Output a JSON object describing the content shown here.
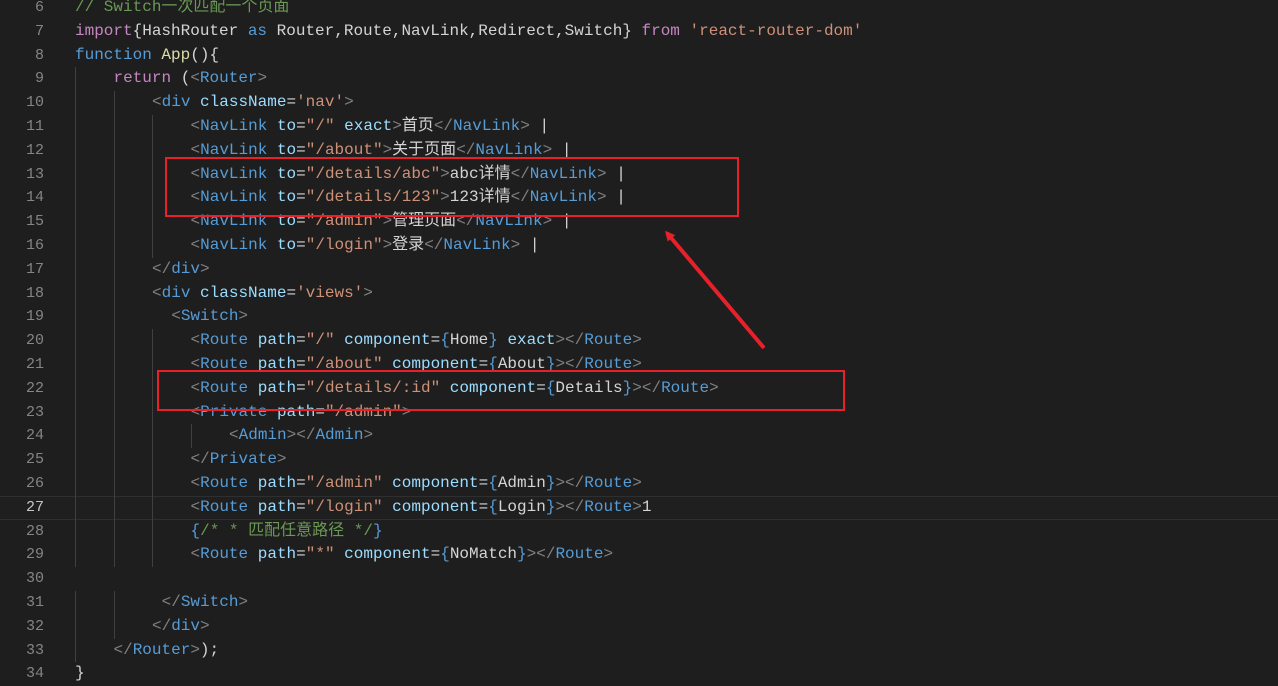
{
  "editor": {
    "current_line": 27,
    "lines": [
      {
        "n": "6",
        "indent": 0,
        "tokens": [
          {
            "t": "cmt",
            "v": "// Switch一次匹配一个页面"
          }
        ]
      },
      {
        "n": "7",
        "indent": 0,
        "tokens": [
          {
            "t": "kw2",
            "v": "import"
          },
          {
            "t": "txt",
            "v": "{HashRouter "
          },
          {
            "t": "kw",
            "v": "as"
          },
          {
            "t": "txt",
            "v": " Router,Route,NavLink,Redirect,Switch} "
          },
          {
            "t": "kw2",
            "v": "from"
          },
          {
            "t": "txt",
            "v": " "
          },
          {
            "t": "str",
            "v": "'react-router-dom'"
          }
        ]
      },
      {
        "n": "8",
        "indent": 0,
        "tokens": [
          {
            "t": "kw",
            "v": "function"
          },
          {
            "t": "txt",
            "v": " "
          },
          {
            "t": "fn",
            "v": "App"
          },
          {
            "t": "txt",
            "v": "(){"
          }
        ]
      },
      {
        "n": "9",
        "indent": 1,
        "tokens": [
          {
            "t": "kw2",
            "v": "return"
          },
          {
            "t": "txt",
            "v": " ("
          },
          {
            "t": "pun",
            "v": "<"
          },
          {
            "t": "tag",
            "v": "Router"
          },
          {
            "t": "pun",
            "v": ">"
          }
        ]
      },
      {
        "n": "10",
        "indent": 2,
        "tokens": [
          {
            "t": "pun",
            "v": "<"
          },
          {
            "t": "tag",
            "v": "div"
          },
          {
            "t": "txt",
            "v": " "
          },
          {
            "t": "attr",
            "v": "className"
          },
          {
            "t": "txt",
            "v": "="
          },
          {
            "t": "str",
            "v": "'nav'"
          },
          {
            "t": "pun",
            "v": ">"
          }
        ]
      },
      {
        "n": "11",
        "indent": 3,
        "tokens": [
          {
            "t": "pun",
            "v": "<"
          },
          {
            "t": "tag",
            "v": "NavLink"
          },
          {
            "t": "txt",
            "v": " "
          },
          {
            "t": "attr",
            "v": "to"
          },
          {
            "t": "txt",
            "v": "="
          },
          {
            "t": "str",
            "v": "\"/\""
          },
          {
            "t": "txt",
            "v": " "
          },
          {
            "t": "attr",
            "v": "exact"
          },
          {
            "t": "pun",
            "v": ">"
          },
          {
            "t": "txt",
            "v": "首页"
          },
          {
            "t": "pun",
            "v": "</"
          },
          {
            "t": "tag",
            "v": "NavLink"
          },
          {
            "t": "pun",
            "v": ">"
          },
          {
            "t": "txt",
            "v": " |"
          }
        ]
      },
      {
        "n": "12",
        "indent": 3,
        "tokens": [
          {
            "t": "pun",
            "v": "<"
          },
          {
            "t": "tag",
            "v": "NavLink"
          },
          {
            "t": "txt",
            "v": " "
          },
          {
            "t": "attr",
            "v": "to"
          },
          {
            "t": "txt",
            "v": "="
          },
          {
            "t": "str",
            "v": "\"/about\""
          },
          {
            "t": "pun",
            "v": ">"
          },
          {
            "t": "txt",
            "v": "关于页面"
          },
          {
            "t": "pun",
            "v": "</"
          },
          {
            "t": "tag",
            "v": "NavLink"
          },
          {
            "t": "pun",
            "v": ">"
          },
          {
            "t": "txt",
            "v": " |"
          }
        ]
      },
      {
        "n": "13",
        "indent": 3,
        "tokens": [
          {
            "t": "pun",
            "v": "<"
          },
          {
            "t": "tag",
            "v": "NavLink"
          },
          {
            "t": "txt",
            "v": " "
          },
          {
            "t": "attr",
            "v": "to"
          },
          {
            "t": "txt",
            "v": "="
          },
          {
            "t": "str",
            "v": "\"/details/abc\""
          },
          {
            "t": "pun",
            "v": ">"
          },
          {
            "t": "txt",
            "v": "abc详情"
          },
          {
            "t": "pun",
            "v": "</"
          },
          {
            "t": "tag",
            "v": "NavLink"
          },
          {
            "t": "pun",
            "v": ">"
          },
          {
            "t": "txt",
            "v": " |"
          }
        ]
      },
      {
        "n": "14",
        "indent": 3,
        "tokens": [
          {
            "t": "pun",
            "v": "<"
          },
          {
            "t": "tag",
            "v": "NavLink"
          },
          {
            "t": "txt",
            "v": " "
          },
          {
            "t": "attr",
            "v": "to"
          },
          {
            "t": "txt",
            "v": "="
          },
          {
            "t": "str",
            "v": "\"/details/123\""
          },
          {
            "t": "pun",
            "v": ">"
          },
          {
            "t": "txt",
            "v": "123详情"
          },
          {
            "t": "pun",
            "v": "</"
          },
          {
            "t": "tag",
            "v": "NavLink"
          },
          {
            "t": "pun",
            "v": ">"
          },
          {
            "t": "txt",
            "v": " |"
          }
        ]
      },
      {
        "n": "15",
        "indent": 3,
        "tokens": [
          {
            "t": "pun",
            "v": "<"
          },
          {
            "t": "tag",
            "v": "NavLink"
          },
          {
            "t": "txt",
            "v": " "
          },
          {
            "t": "attr",
            "v": "to"
          },
          {
            "t": "txt",
            "v": "="
          },
          {
            "t": "str",
            "v": "\"/admin\""
          },
          {
            "t": "pun",
            "v": ">"
          },
          {
            "t": "txt",
            "v": "管理页面"
          },
          {
            "t": "pun",
            "v": "</"
          },
          {
            "t": "tag",
            "v": "NavLink"
          },
          {
            "t": "pun",
            "v": ">"
          },
          {
            "t": "txt",
            "v": " |"
          }
        ]
      },
      {
        "n": "16",
        "indent": 3,
        "tokens": [
          {
            "t": "pun",
            "v": "<"
          },
          {
            "t": "tag",
            "v": "NavLink"
          },
          {
            "t": "txt",
            "v": " "
          },
          {
            "t": "attr",
            "v": "to"
          },
          {
            "t": "txt",
            "v": "="
          },
          {
            "t": "str",
            "v": "\"/login\""
          },
          {
            "t": "pun",
            "v": ">"
          },
          {
            "t": "txt",
            "v": "登录"
          },
          {
            "t": "pun",
            "v": "</"
          },
          {
            "t": "tag",
            "v": "NavLink"
          },
          {
            "t": "pun",
            "v": ">"
          },
          {
            "t": "txt",
            "v": " |"
          }
        ]
      },
      {
        "n": "17",
        "indent": 2,
        "tokens": [
          {
            "t": "pun",
            "v": "</"
          },
          {
            "t": "tag",
            "v": "div"
          },
          {
            "t": "pun",
            "v": ">"
          }
        ]
      },
      {
        "n": "18",
        "indent": 2,
        "tokens": [
          {
            "t": "pun",
            "v": "<"
          },
          {
            "t": "tag",
            "v": "div"
          },
          {
            "t": "txt",
            "v": " "
          },
          {
            "t": "attr",
            "v": "className"
          },
          {
            "t": "txt",
            "v": "="
          },
          {
            "t": "str",
            "v": "'views'"
          },
          {
            "t": "pun",
            "v": ">"
          }
        ]
      },
      {
        "n": "19",
        "indent": 2,
        "tokens": [
          {
            "t": "txt",
            "v": "  "
          },
          {
            "t": "pun",
            "v": "<"
          },
          {
            "t": "tag",
            "v": "Switch"
          },
          {
            "t": "pun",
            "v": ">"
          }
        ]
      },
      {
        "n": "20",
        "indent": 3,
        "tokens": [
          {
            "t": "pun",
            "v": "<"
          },
          {
            "t": "tag",
            "v": "Route"
          },
          {
            "t": "txt",
            "v": " "
          },
          {
            "t": "attr",
            "v": "path"
          },
          {
            "t": "txt",
            "v": "="
          },
          {
            "t": "str",
            "v": "\"/\""
          },
          {
            "t": "txt",
            "v": " "
          },
          {
            "t": "attr",
            "v": "component"
          },
          {
            "t": "txt",
            "v": "="
          },
          {
            "t": "brc2",
            "v": "{"
          },
          {
            "t": "txt",
            "v": "Home"
          },
          {
            "t": "brc2",
            "v": "}"
          },
          {
            "t": "txt",
            "v": " "
          },
          {
            "t": "attr",
            "v": "exact"
          },
          {
            "t": "pun",
            "v": "></"
          },
          {
            "t": "tag",
            "v": "Route"
          },
          {
            "t": "pun",
            "v": ">"
          }
        ]
      },
      {
        "n": "21",
        "indent": 3,
        "tokens": [
          {
            "t": "pun",
            "v": "<"
          },
          {
            "t": "tag",
            "v": "Route"
          },
          {
            "t": "txt",
            "v": " "
          },
          {
            "t": "attr",
            "v": "path"
          },
          {
            "t": "txt",
            "v": "="
          },
          {
            "t": "str",
            "v": "\"/about\""
          },
          {
            "t": "txt",
            "v": " "
          },
          {
            "t": "attr",
            "v": "component"
          },
          {
            "t": "txt",
            "v": "="
          },
          {
            "t": "brc2",
            "v": "{"
          },
          {
            "t": "txt",
            "v": "About"
          },
          {
            "t": "brc2",
            "v": "}"
          },
          {
            "t": "pun",
            "v": "></"
          },
          {
            "t": "tag",
            "v": "Route"
          },
          {
            "t": "pun",
            "v": ">"
          }
        ]
      },
      {
        "n": "22",
        "indent": 3,
        "tokens": [
          {
            "t": "pun",
            "v": "<"
          },
          {
            "t": "tag",
            "v": "Route"
          },
          {
            "t": "txt",
            "v": " "
          },
          {
            "t": "attr",
            "v": "path"
          },
          {
            "t": "txt",
            "v": "="
          },
          {
            "t": "str",
            "v": "\"/details/:id\""
          },
          {
            "t": "txt",
            "v": " "
          },
          {
            "t": "attr",
            "v": "component"
          },
          {
            "t": "txt",
            "v": "="
          },
          {
            "t": "brc2",
            "v": "{"
          },
          {
            "t": "txt",
            "v": "Details"
          },
          {
            "t": "brc2",
            "v": "}"
          },
          {
            "t": "pun",
            "v": "></"
          },
          {
            "t": "tag",
            "v": "Route"
          },
          {
            "t": "pun",
            "v": ">"
          }
        ]
      },
      {
        "n": "23",
        "indent": 3,
        "tokens": [
          {
            "t": "pun",
            "v": "<"
          },
          {
            "t": "tag",
            "v": "Private"
          },
          {
            "t": "txt",
            "v": " "
          },
          {
            "t": "attr",
            "v": "path"
          },
          {
            "t": "txt",
            "v": "="
          },
          {
            "t": "str",
            "v": "\"/admin\""
          },
          {
            "t": "pun",
            "v": ">"
          }
        ]
      },
      {
        "n": "24",
        "indent": 4,
        "tokens": [
          {
            "t": "pun",
            "v": "<"
          },
          {
            "t": "tag",
            "v": "Admin"
          },
          {
            "t": "pun",
            "v": "></"
          },
          {
            "t": "tag",
            "v": "Admin"
          },
          {
            "t": "pun",
            "v": ">"
          }
        ]
      },
      {
        "n": "25",
        "indent": 3,
        "tokens": [
          {
            "t": "pun",
            "v": "</"
          },
          {
            "t": "tag",
            "v": "Private"
          },
          {
            "t": "pun",
            "v": ">"
          }
        ]
      },
      {
        "n": "26",
        "indent": 3,
        "tokens": [
          {
            "t": "pun",
            "v": "<"
          },
          {
            "t": "tag",
            "v": "Route"
          },
          {
            "t": "txt",
            "v": " "
          },
          {
            "t": "attr",
            "v": "path"
          },
          {
            "t": "txt",
            "v": "="
          },
          {
            "t": "str",
            "v": "\"/admin\""
          },
          {
            "t": "txt",
            "v": " "
          },
          {
            "t": "attr",
            "v": "component"
          },
          {
            "t": "txt",
            "v": "="
          },
          {
            "t": "brc2",
            "v": "{"
          },
          {
            "t": "txt",
            "v": "Admin"
          },
          {
            "t": "brc2",
            "v": "}"
          },
          {
            "t": "pun",
            "v": "></"
          },
          {
            "t": "tag",
            "v": "Route"
          },
          {
            "t": "pun",
            "v": ">"
          }
        ]
      },
      {
        "n": "27",
        "indent": 3,
        "tokens": [
          {
            "t": "pun",
            "v": "<"
          },
          {
            "t": "tag",
            "v": "Route"
          },
          {
            "t": "txt",
            "v": " "
          },
          {
            "t": "attr",
            "v": "path"
          },
          {
            "t": "txt",
            "v": "="
          },
          {
            "t": "str",
            "v": "\"/login\""
          },
          {
            "t": "txt",
            "v": " "
          },
          {
            "t": "attr",
            "v": "component"
          },
          {
            "t": "txt",
            "v": "="
          },
          {
            "t": "brc2",
            "v": "{"
          },
          {
            "t": "txt",
            "v": "Login"
          },
          {
            "t": "brc2",
            "v": "}"
          },
          {
            "t": "pun",
            "v": "></"
          },
          {
            "t": "tag",
            "v": "Route"
          },
          {
            "t": "pun",
            "v": ">"
          },
          {
            "t": "txt",
            "v": "1"
          }
        ]
      },
      {
        "n": "28",
        "indent": 3,
        "tokens": [
          {
            "t": "brc2",
            "v": "{"
          },
          {
            "t": "cmt",
            "v": "/* * 匹配任意路径 */"
          },
          {
            "t": "brc2",
            "v": "}"
          }
        ]
      },
      {
        "n": "29",
        "indent": 3,
        "tokens": [
          {
            "t": "pun",
            "v": "<"
          },
          {
            "t": "tag",
            "v": "Route"
          },
          {
            "t": "txt",
            "v": " "
          },
          {
            "t": "attr",
            "v": "path"
          },
          {
            "t": "txt",
            "v": "="
          },
          {
            "t": "str",
            "v": "\"*\""
          },
          {
            "t": "txt",
            "v": " "
          },
          {
            "t": "attr",
            "v": "component"
          },
          {
            "t": "txt",
            "v": "="
          },
          {
            "t": "brc2",
            "v": "{"
          },
          {
            "t": "txt",
            "v": "NoMatch"
          },
          {
            "t": "brc2",
            "v": "}"
          },
          {
            "t": "pun",
            "v": "></"
          },
          {
            "t": "tag",
            "v": "Route"
          },
          {
            "t": "pun",
            "v": ">"
          }
        ]
      },
      {
        "n": "30",
        "indent": 0,
        "tokens": []
      },
      {
        "n": "31",
        "indent": 2,
        "tokens": [
          {
            "t": "txt",
            "v": " "
          },
          {
            "t": "pun",
            "v": "</"
          },
          {
            "t": "tag",
            "v": "Switch"
          },
          {
            "t": "pun",
            "v": ">"
          }
        ]
      },
      {
        "n": "32",
        "indent": 2,
        "tokens": [
          {
            "t": "pun",
            "v": "</"
          },
          {
            "t": "tag",
            "v": "div"
          },
          {
            "t": "pun",
            "v": ">"
          }
        ]
      },
      {
        "n": "33",
        "indent": 1,
        "tokens": [
          {
            "t": "pun",
            "v": "</"
          },
          {
            "t": "tag",
            "v": "Router"
          },
          {
            "t": "pun",
            "v": ">"
          },
          {
            "t": "txt",
            "v": ");"
          }
        ]
      },
      {
        "n": "34",
        "indent": 0,
        "tokens": [
          {
            "t": "txt",
            "v": "}"
          }
        ]
      }
    ]
  },
  "annotations": {
    "color": "#e8202a"
  }
}
